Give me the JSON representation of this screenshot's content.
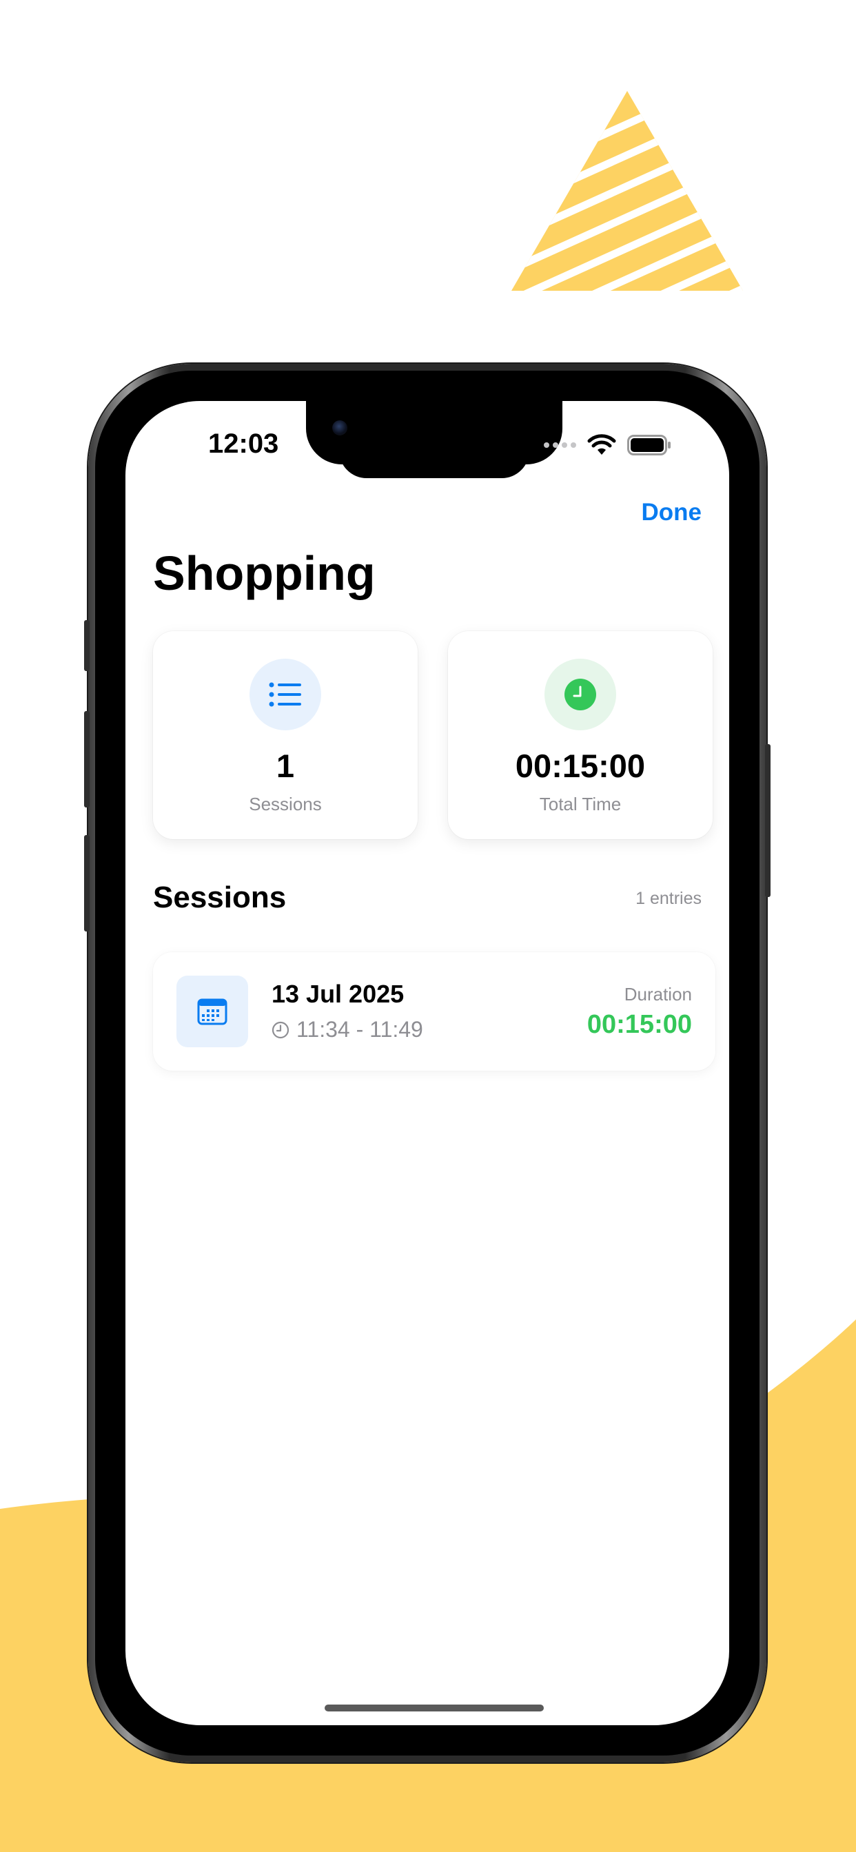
{
  "colors": {
    "background": "#ffffff",
    "decoration_yellow": "#fdd262",
    "accent_blue": "#0a7cf0",
    "accent_green": "#34c759",
    "secondary_text": "#8e8e93"
  },
  "status_bar": {
    "time": "12:03"
  },
  "nav": {
    "done_label": "Done"
  },
  "header": {
    "title": "Shopping"
  },
  "stats": [
    {
      "icon": "list-icon",
      "value": "1",
      "label": "Sessions",
      "icon_bg": "#e7f1fd",
      "icon_color": "#0a7cf0"
    },
    {
      "icon": "clock-icon",
      "value": "00:15:00",
      "label": "Total Time",
      "icon_bg": "#e6f6ea",
      "icon_color": "#34c759"
    }
  ],
  "sessions": {
    "title": "Sessions",
    "count_label": "1 entries",
    "items": [
      {
        "icon": "calendar-icon",
        "date": "13 Jul 2025",
        "time_range": "11:34 - 11:49",
        "duration_label": "Duration",
        "duration_value": "00:15:00"
      }
    ]
  }
}
